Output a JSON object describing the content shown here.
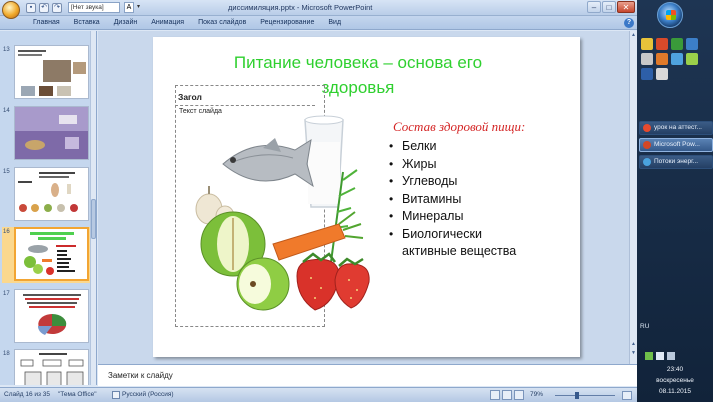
{
  "window": {
    "title": "диссимиляция.pptx - Microsoft PowerPoint",
    "qat_combo": "[Нет звука]",
    "qat_font_glyph": "A",
    "minimize": "–",
    "maximize": "□",
    "close": "✕"
  },
  "ribbon": {
    "tabs": [
      "Главная",
      "Вставка",
      "Дизайн",
      "Анимация",
      "Показ слайдов",
      "Рецензирование",
      "Вид"
    ],
    "help": "?"
  },
  "thumbnails": [
    {
      "num": "13",
      "active": false
    },
    {
      "num": "14",
      "active": false
    },
    {
      "num": "15",
      "active": false
    },
    {
      "num": "16",
      "active": true
    },
    {
      "num": "17",
      "active": false
    },
    {
      "num": "18",
      "active": false
    }
  ],
  "slide": {
    "title": "Питание человека – основа его здоровья",
    "placeholder_title": "Загол",
    "placeholder_body": "Текст слайда",
    "subtitle": "Состав здоровой пищи:",
    "bullets": [
      "Белки",
      "Жиры",
      "Углеводы",
      "Витамины",
      "Минералы",
      "Биологически активные вещества"
    ]
  },
  "notes": {
    "placeholder": "Заметки к слайду"
  },
  "status": {
    "slide_counter": "Слайд 16 из 35",
    "theme": "\"Тема Office\"",
    "language": "Русский (Россия)",
    "zoom": "79%"
  },
  "taskbar": {
    "items": [
      {
        "label": "урок на аттест...",
        "active": false,
        "color": "#e64a2e"
      },
      {
        "label": "Microsoft Pow...",
        "active": true,
        "color": "#d24726"
      },
      {
        "label": "Потоки энерг...",
        "active": false,
        "color": "#4aa3df"
      }
    ],
    "lang": "RU",
    "time": "23:40",
    "day": "воскресенье",
    "date": "08.11.2015"
  },
  "colors": {
    "title_green": "#2fd02f",
    "subtitle_red": "#d42424",
    "active_thumb": "#f2a533"
  }
}
